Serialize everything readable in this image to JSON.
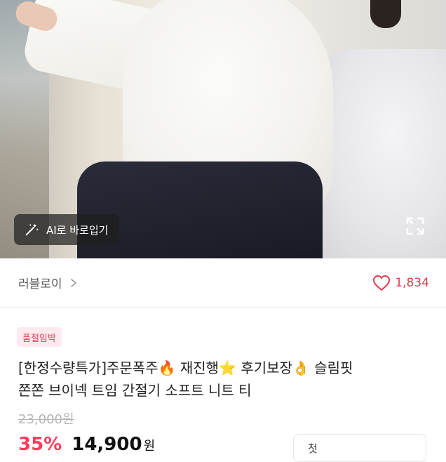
{
  "photo": {
    "ai_try_on_label": "AI로 바로입기",
    "wand_icon": "magic-wand-icon",
    "expand_icon": "expand-icon"
  },
  "seller": {
    "name": "러블로이",
    "chevron_icon": "chevron-right-icon"
  },
  "likes": {
    "count": "1,834",
    "icon": "heart-outline-icon",
    "color": "#e23a4f"
  },
  "product": {
    "badge": "품절임박",
    "title_line1": "[한정수량특가]주문폭주🔥 재진행⭐ 후기보장👌 슬림핏",
    "title_line2": "쫀쫀 브이넥 트임 간절기 소프트 니트 티",
    "original_price": "23,000원",
    "discount": "35%",
    "price": "14,900",
    "price_unit": "원",
    "coupon_prefix": "첫",
    "coupon_highlight": "",
    "coupon_suffix": ""
  },
  "colors": {
    "accent": "#ff3d5a",
    "badge_bg": "#fde9ee"
  }
}
